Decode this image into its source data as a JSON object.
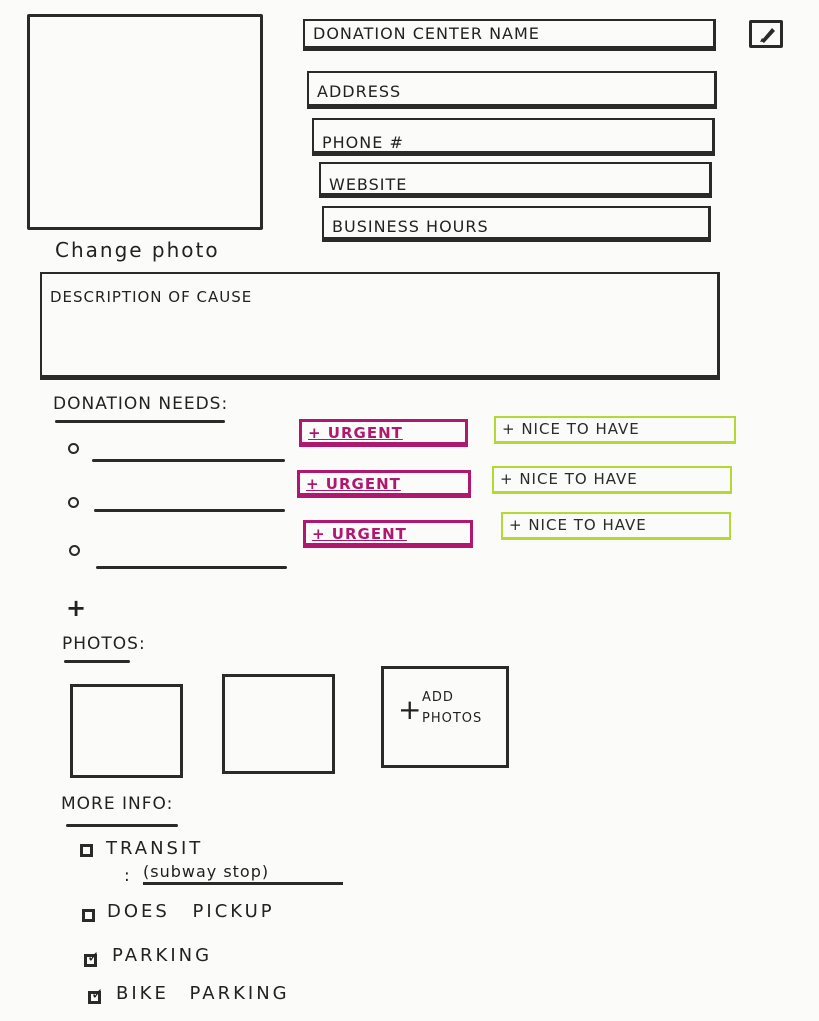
{
  "profile": {
    "change_photo_label": "Change photo",
    "fields": [
      "DONATION CENTER NAME",
      "ADDRESS",
      "PHONE #",
      "WEBSITE",
      "BUSINESS HOURS"
    ],
    "edit_icon": "pencil-icon",
    "description_placeholder": "DESCRIPTION OF CAUSE"
  },
  "donation_needs": {
    "heading": "DONATION NEEDS:",
    "urgent_label": "+ URGENT",
    "nice_label": "+ NICE TO HAVE",
    "add_symbol": "+",
    "colors": {
      "urgent": "#b0176f",
      "nice_to_have": "#b4d935"
    }
  },
  "photos": {
    "heading": "PHOTOS:",
    "add_symbol": "+",
    "add_label": "ADD PHOTOS"
  },
  "more_info": {
    "heading": "MORE INFO:",
    "items": [
      {
        "label": "TRANSIT",
        "checked": false
      },
      {
        "label": "DOES PICKUP",
        "checked": false
      },
      {
        "label": "PARKING",
        "checked": true
      },
      {
        "label": "BIKE PARKING",
        "checked": true
      }
    ],
    "transit_note": "(subway stop)",
    "transit_prefix": ":"
  }
}
